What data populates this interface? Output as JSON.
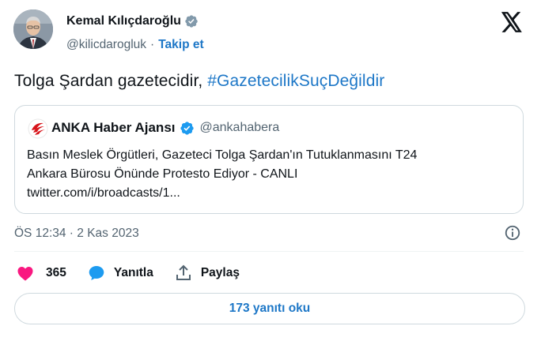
{
  "author": {
    "name": "Kemal Kılıçdaroğlu",
    "handle": "@kilicdarogluk",
    "separator": "·",
    "follow_label": "Takip et"
  },
  "tweet": {
    "text": "Tolga Şardan gazetecidir, ",
    "hashtag": "#GazetecilikSuçDeğildir"
  },
  "quote": {
    "name": "ANKA Haber Ajansı",
    "handle": "@ankahabera",
    "line1": "Basın Meslek Örgütleri, Gazeteci Tolga Şardan'ın Tutuklanmasını T24",
    "line2": "Ankara Bürosu Önünde Protesto Ediyor - CANLI",
    "line3": "twitter.com/i/broadcasts/1..."
  },
  "meta": {
    "timestamp": "ÖS 12:34 · 2 Kas 2023"
  },
  "actions": {
    "likes": "365",
    "reply_label": "Yanıtla",
    "share_label": "Paylaş"
  },
  "replies_button": "173 yanıtı oku",
  "colors": {
    "accent": "#1d77c7",
    "like": "#f91880",
    "verified_gray": "#829aab",
    "verified_blue": "#1d9bf0"
  },
  "icons": [
    "verified-gray-icon",
    "x-logo-icon",
    "verified-blue-icon",
    "info-icon",
    "heart-icon",
    "comment-icon",
    "share-icon"
  ]
}
